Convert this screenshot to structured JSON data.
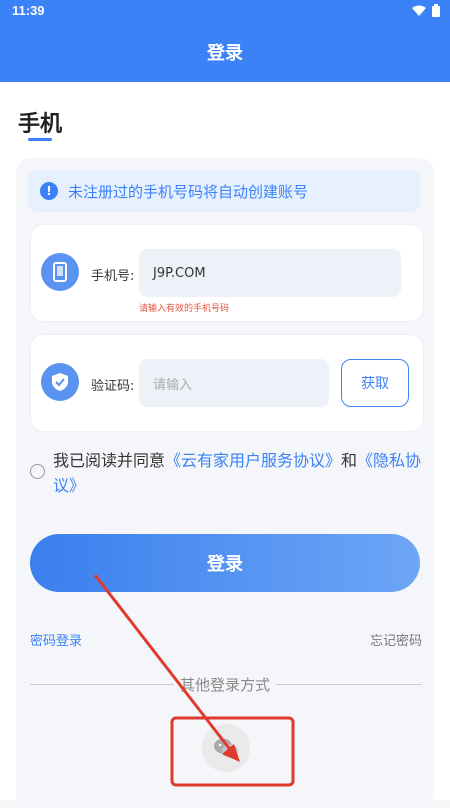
{
  "status_bar": {
    "time": "11:39",
    "wifi_icon": "wifi-icon",
    "battery_icon": "battery-icon"
  },
  "header": {
    "title": "登录"
  },
  "section": {
    "title": "手机"
  },
  "notice": {
    "icon": "info-icon",
    "text": "未注册过的手机号码将自动创建账号"
  },
  "phone_field": {
    "icon": "phone-icon",
    "label": "手机号:",
    "value": "J9P.COM",
    "error": "请输入有效的手机号码"
  },
  "code_field": {
    "icon": "shield-check-icon",
    "label": "验证码:",
    "placeholder": "请输入",
    "get_button": "获取"
  },
  "agreement": {
    "prefix": "我已阅读并同意",
    "terms": "《云有家用户服务协议》",
    "and": "和",
    "privacy": "《隐私协议》",
    "checked": false
  },
  "login_button": {
    "label": "登录"
  },
  "links": {
    "password_login": "密码登录",
    "forgot_password": "忘记密码"
  },
  "other_login": {
    "label": "其他登录方式",
    "wechat_icon": "wechat-icon"
  },
  "colors": {
    "primary": "#3b82f6",
    "error": "#e25545",
    "annotation": "#e03a2f"
  }
}
